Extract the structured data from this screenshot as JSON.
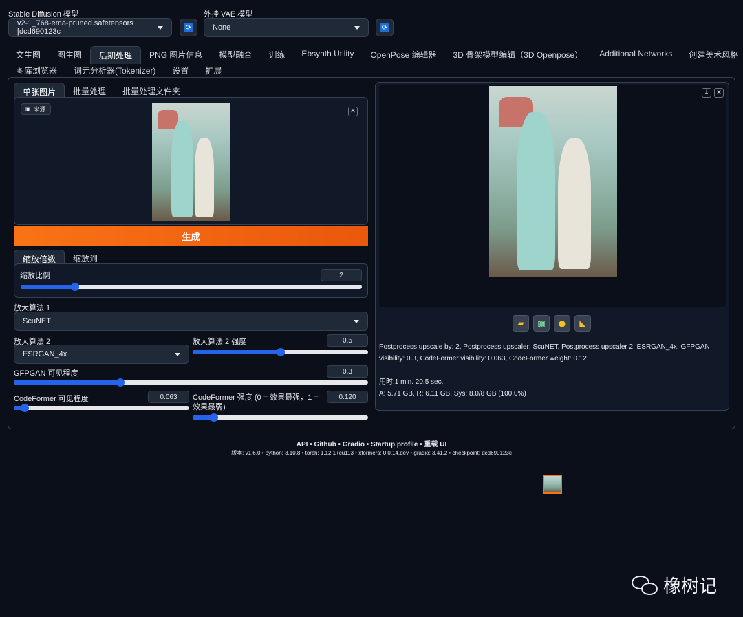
{
  "header": {
    "sd_model_label": "Stable Diffusion 模型",
    "sd_model_value": "v2-1_768-ema-pruned.safetensors [dcd690123c",
    "vae_label": "外挂 VAE 模型",
    "vae_value": "None"
  },
  "tabs_row1": [
    "文生图",
    "图生图",
    "后期处理",
    "PNG 图片信息",
    "模型融合",
    "训练",
    "Ebsynth Utility",
    "OpenPose 编辑器",
    "3D 骨架模型编辑（3D Openpose）",
    "Additional Networks",
    "创建美术风格"
  ],
  "tabs_row2": [
    "图库浏览器",
    "词元分析器(Tokenizer)",
    "设置",
    "扩展"
  ],
  "subtabs": [
    "单张图片",
    "批量处理",
    "批量处理文件夹"
  ],
  "source_label": "来源",
  "generate_label": "生成",
  "scale_tabs": [
    "缩放倍数",
    "缩放到"
  ],
  "scale": {
    "label": "缩放比例",
    "value": "2",
    "fraction": 0.16
  },
  "upscaler1": {
    "label": "放大算法 1",
    "value": "ScuNET"
  },
  "upscaler2": {
    "label": "放大算法 2",
    "value": "ESRGAN_4x"
  },
  "upscaler2_strength": {
    "label": "放大算法 2 强度",
    "value": "0.5",
    "fraction": 0.5
  },
  "gfpgan": {
    "label": "GFPGAN 可见程度",
    "value": "0.3",
    "fraction": 0.3
  },
  "codeformer_vis": {
    "label": "CodeFormer 可见程度",
    "value": "0.063",
    "fraction": 0.063
  },
  "codeformer_weight": {
    "label": "CodeFormer 强度 (0 = 效果最强，1 = 效果最弱)",
    "value": "0.120",
    "fraction": 0.12
  },
  "output": {
    "info": "Postprocess upscale by: 2, Postprocess upscaler: ScuNET, Postprocess upscaler 2: ESRGAN_4x, GFPGAN visibility: 0.3, CodeFormer visibility: 0.063, CodeFormer weight: 0.12",
    "time": "用时:1 min. 20.5 sec.",
    "memory": "A: 5.71 GB, R: 6.11 GB, Sys: 8.0/8 GB (100.0%)"
  },
  "footer": {
    "links": "API • Github • Gradio • Startup profile • 重载 UI",
    "versions": "版本: v1.6.0  •  python: 3.10.8  •  torch: 1.12.1+cu113  •  xformers: 0.0.14.dev  •  gradio: 3.41.2  •  checkpoint: dcd690123c"
  },
  "watermark": "橡树记"
}
